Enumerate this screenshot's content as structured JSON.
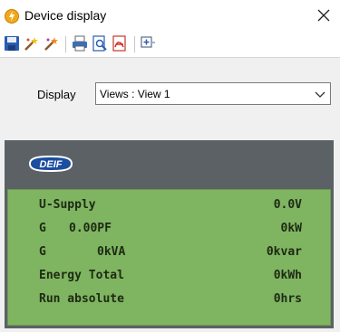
{
  "window": {
    "title": "Device display",
    "close_symbol": "✕"
  },
  "toolbar": {
    "buttons": [
      "save-icon",
      "wand-icon",
      "wand-alt-icon",
      "print-icon",
      "print-preview-icon",
      "pdf-export-icon",
      "add-view-icon"
    ]
  },
  "display": {
    "label": "Display",
    "selected": "Views : View 1"
  },
  "device": {
    "logo": "DEIF",
    "lcd_color": "#7fb461",
    "rows": [
      {
        "a": "U-Supply",
        "b": "",
        "right": "0.0V"
      },
      {
        "a": "G",
        "b": "0.00PF",
        "right": "0kW"
      },
      {
        "a": "G",
        "b": "0kVA",
        "right": "0kvar"
      },
      {
        "a": "Energy Total",
        "b": "",
        "right": "0kWh"
      },
      {
        "a": "Run absolute",
        "b": "",
        "right": "0hrs"
      }
    ]
  }
}
